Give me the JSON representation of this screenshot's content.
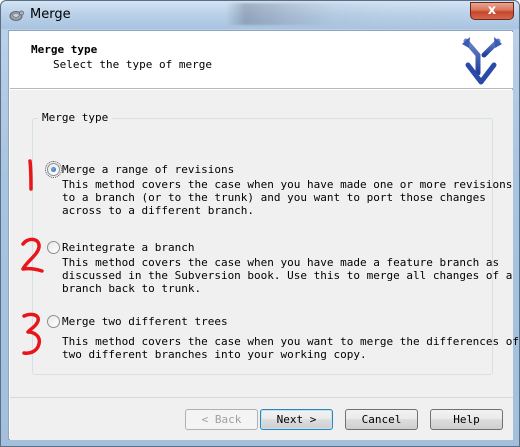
{
  "window": {
    "title": "Merge",
    "close_glyph": "x"
  },
  "header": {
    "title": "Merge type",
    "subtitle": "Select the type of merge",
    "logo_icon": "merge-arrows-icon"
  },
  "group": {
    "label": "Merge type",
    "options": [
      {
        "label": "Merge a range of revisions",
        "selected": true,
        "description_lines": [
          "This method covers the case when you have made one or more revisions",
          "to a branch (or to the trunk) and you want to port those changes",
          "across to a different branch."
        ]
      },
      {
        "label": "Reintegrate a branch",
        "selected": false,
        "description_lines": [
          "This method covers the case when you have made a feature branch as",
          "discussed in the Subversion book. Use this to merge all changes of a",
          "branch back to trunk."
        ]
      },
      {
        "label": "Merge two different trees",
        "selected": false,
        "description_lines": [
          "This method covers the case when you want to merge the differences of",
          "two different branches into your working copy."
        ]
      }
    ]
  },
  "buttons": {
    "back": "< Back",
    "next": "Next >",
    "cancel": "Cancel",
    "help": "Help"
  },
  "annotations": {
    "color": "#e8161b",
    "marks": [
      "1",
      "2",
      "3"
    ]
  }
}
